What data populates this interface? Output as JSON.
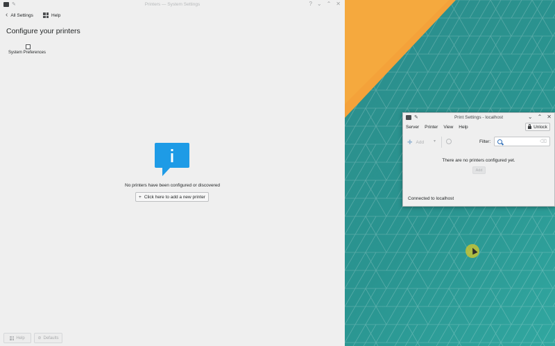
{
  "settings_window": {
    "title": "Printers — System Settings",
    "toolbar": {
      "back_label": "All Settings",
      "help_label": "Help"
    },
    "page_title": "Configure your printers",
    "sysprefs_label": "System Preferences",
    "empty_message": "No printers have been configured or discovered",
    "add_printer_button": "Click here to add a new printer",
    "footer": {
      "help_label": "Help",
      "defaults_label": "Defaults"
    }
  },
  "print_window": {
    "title": "Print Settings - localhost",
    "menu": [
      "Server",
      "Printer",
      "View",
      "Help"
    ],
    "unlock_label": "Unlock",
    "toolbar": {
      "add_label": "Add",
      "filter_label": "Filter:",
      "filter_value": ""
    },
    "empty_message": "There are no printers configured yet.",
    "add_button": "Add",
    "status": "Connected to localhost"
  },
  "colors": {
    "wallpaper_teal": "#2a9490",
    "wallpaper_orange": "#f4a23a",
    "info_icon_blue": "#1e9be6",
    "window_bg": "#efefef"
  },
  "icons": [
    "app-icon",
    "pin-icon",
    "chevron-left-icon",
    "help-grid-icon",
    "system-preferences-icon",
    "info-icon",
    "plus-icon",
    "lock-icon",
    "refresh-icon",
    "search-icon",
    "clear-icon"
  ]
}
